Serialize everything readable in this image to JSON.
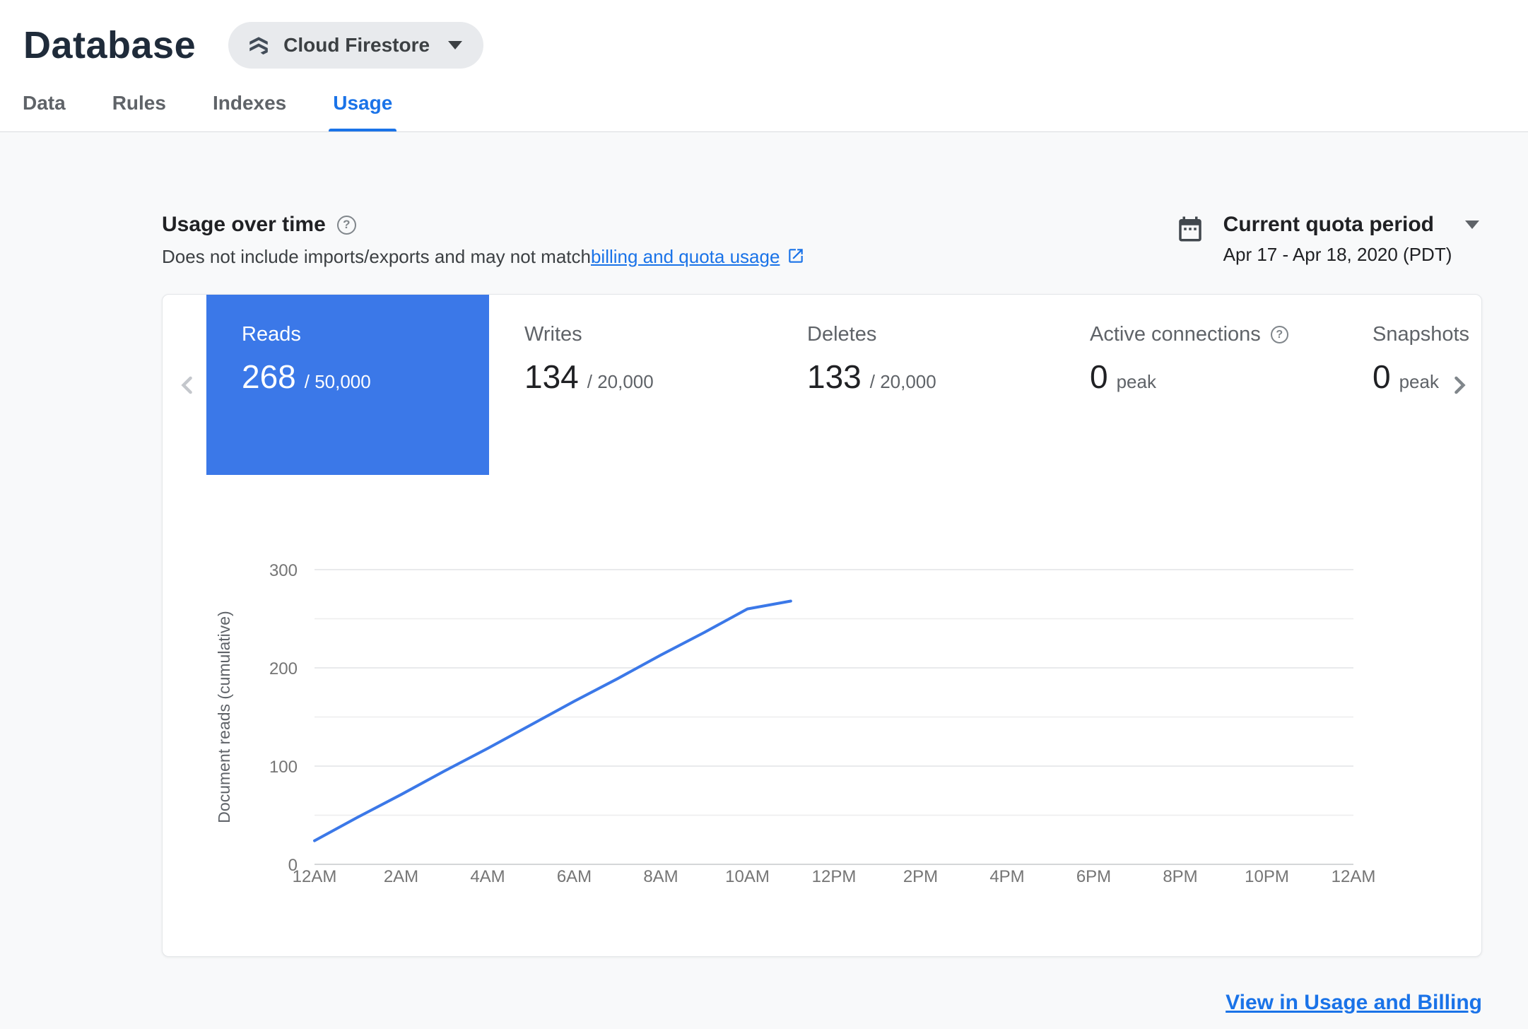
{
  "colors": {
    "accent_blue": "#1a73e8",
    "selected_metric_blue": "#3b78e8",
    "chart_line": "#3b78e8"
  },
  "header": {
    "title": "Database",
    "product_selector_label": "Cloud Firestore"
  },
  "tabs": [
    {
      "label": "Data"
    },
    {
      "label": "Rules"
    },
    {
      "label": "Indexes"
    },
    {
      "label": "Usage"
    }
  ],
  "active_tab": "Usage",
  "usage_section": {
    "title": "Usage over time",
    "subtitle_prefix": "Does not include imports/exports and may not match ",
    "subtitle_link_text": "billing and quota usage",
    "quota_period_label": "Current quota period",
    "quota_period_range": "Apr 17 - Apr 18, 2020 (PDT)"
  },
  "metrics": [
    {
      "name": "Reads",
      "value": "268",
      "denominator": "/ 50,000",
      "selected": true
    },
    {
      "name": "Writes",
      "value": "134",
      "denominator": "/ 20,000",
      "selected": false
    },
    {
      "name": "Deletes",
      "value": "133",
      "denominator": "/ 20,000",
      "selected": false
    },
    {
      "name": "Active connections",
      "value": "0",
      "denominator": "peak",
      "selected": false
    },
    {
      "name": "Snapshots",
      "value": "0",
      "denominator": "peak",
      "selected": false
    }
  ],
  "footer_link": "View in Usage and Billing",
  "chart_data": {
    "type": "line",
    "title": "",
    "xlabel": "",
    "ylabel": "Document reads (cumulative)",
    "x_tick_labels": [
      "12AM",
      "2AM",
      "4AM",
      "6AM",
      "8AM",
      "10AM",
      "12PM",
      "2PM",
      "4PM",
      "6PM",
      "8PM",
      "10PM",
      "12AM"
    ],
    "x_tick_hours": [
      0,
      2,
      4,
      6,
      8,
      10,
      12,
      14,
      16,
      18,
      20,
      22,
      24
    ],
    "y_ticks": [
      0,
      100,
      200,
      300
    ],
    "ylim": [
      0,
      300
    ],
    "xlim_hours": [
      0,
      24
    ],
    "grid_step": 50,
    "grid": true,
    "legend": "none",
    "series": [
      {
        "name": "Document reads (cumulative)",
        "color": "#3b78e8",
        "points": [
          [
            0,
            24
          ],
          [
            1,
            48
          ],
          [
            2,
            71
          ],
          [
            3,
            95
          ],
          [
            4,
            118
          ],
          [
            5,
            142
          ],
          [
            6,
            166
          ],
          [
            7,
            189
          ],
          [
            8,
            213
          ],
          [
            9,
            236
          ],
          [
            10,
            260
          ],
          [
            11,
            268
          ]
        ]
      }
    ]
  }
}
